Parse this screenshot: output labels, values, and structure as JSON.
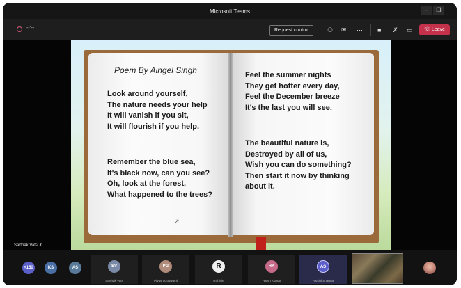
{
  "window": {
    "title": "Microsoft Teams"
  },
  "toolbar": {
    "timer": "--:--",
    "request_control": "Request control",
    "leave_label": "Leave",
    "icons": [
      "participants-icon",
      "chat-icon",
      "more-icon",
      "camera-icon",
      "mic-off-icon",
      "share-tray-icon"
    ]
  },
  "poem": {
    "title": "Poem By Aingel Singh",
    "left_stanzas": [
      [
        "Look around yourself,",
        "The nature needs your help",
        "It will vanish if you sit,",
        "It will flourish if you help."
      ],
      [
        "Remember the blue sea,",
        "It's black now, can you see?",
        "Oh, look at the forest,",
        "What happened to the trees?"
      ]
    ],
    "right_stanzas": [
      [
        "Feel the summer nights",
        "They get hotter every day,",
        "Feel the December breeze",
        "It's the last you will see."
      ],
      [
        "The beautiful nature is,",
        "Destroyed by all of us,",
        "Wish you can do something?",
        "Then start it now by thinking",
        "about it."
      ]
    ]
  },
  "presenter_label": "Sarthak Vats",
  "participants": {
    "more_count": "+150",
    "small": [
      "KS",
      "AS"
    ],
    "tiles": [
      {
        "initials": "SV",
        "name": "Sarthak Vats"
      },
      {
        "initials": "PG",
        "name": "Piyush Goswami"
      },
      {
        "initials": "R",
        "name": "Rohinie"
      },
      {
        "initials": "HK",
        "name": "Harsh Kumar"
      },
      {
        "initials": "AS",
        "name": "Aarohi Sharma"
      }
    ]
  },
  "colors": {
    "leave": "#c4314b",
    "book_cover": "#9a6a3a",
    "accent": "#6264a7"
  }
}
